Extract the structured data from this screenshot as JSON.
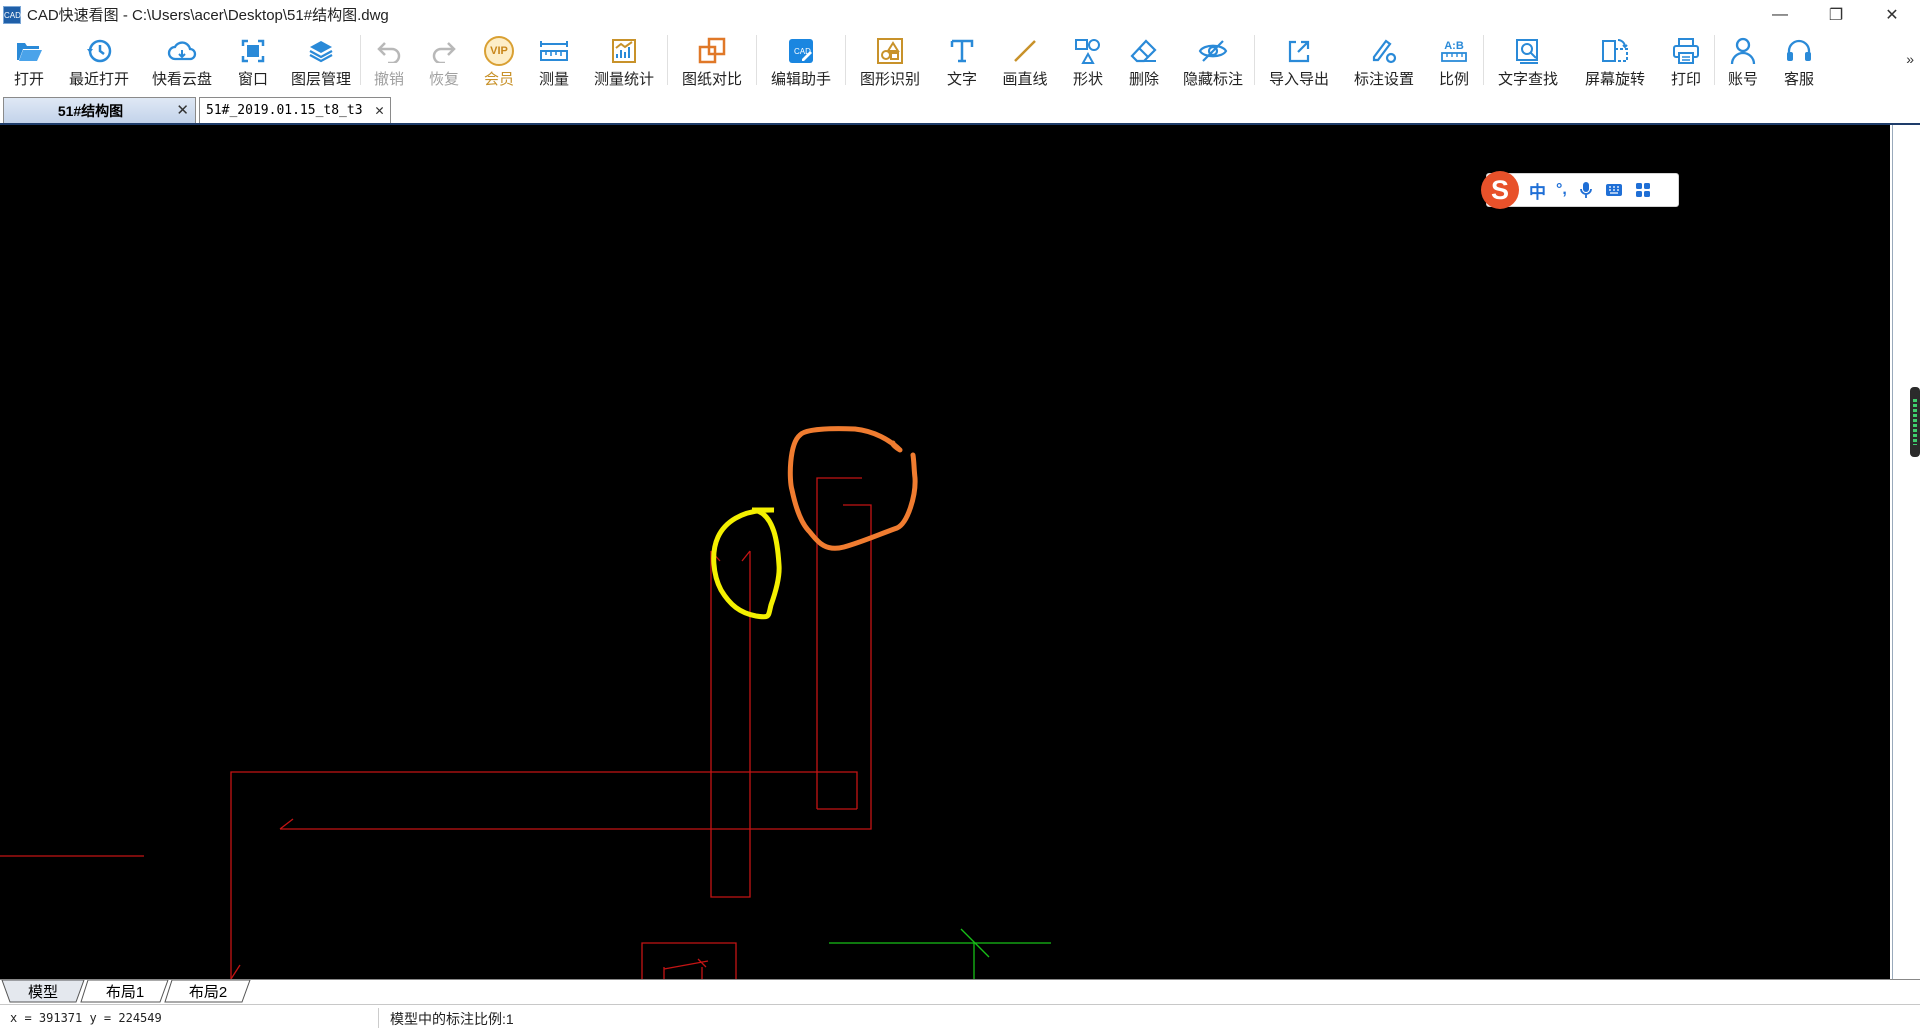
{
  "window": {
    "title": "CAD快速看图 - C:\\Users\\acer\\Desktop\\51#结构图.dwg",
    "logo_text": "CAD",
    "minimize": "—",
    "restore": "❐",
    "close": "✕"
  },
  "toolbar": {
    "open": "打开",
    "recent": "最近打开",
    "cloud": "快看云盘",
    "window": "窗口",
    "layers": "图层管理",
    "undo": "撤销",
    "redo": "恢复",
    "vip": "会员",
    "vip_badge": "VIP",
    "measure": "测量",
    "measure_stats": "测量统计",
    "compare": "图纸对比",
    "edit_helper": "编辑助手",
    "shape_recognition": "图形识别",
    "text": "文字",
    "line": "画直线",
    "shape": "形状",
    "delete": "删除",
    "hide_annotation": "隐藏标注",
    "import_export": "导入导出",
    "annotation_settings": "标注设置",
    "ratio": "比例",
    "ratio_badge": "A:B",
    "text_search": "文字查找",
    "screen_rotate": "屏幕旋转",
    "print": "打印",
    "account": "账号",
    "support": "客服",
    "more": "»"
  },
  "tabs": [
    {
      "label": "51#结构图",
      "close": "✕"
    },
    {
      "label": "51#_2019.01.15_t8_t3",
      "close": "✕"
    }
  ],
  "ime": {
    "logo": "S",
    "mode": "中",
    "punct": "°,"
  },
  "layout_tabs": [
    "模型",
    "布局1",
    "布局2"
  ],
  "status": {
    "coords": "x = 391371  y = 224549",
    "scale": "模型中的标注比例:1"
  },
  "colors": {
    "drawing_line": "#c41414",
    "annotation_yellow": "#f4f000",
    "annotation_orange": "#f07c30",
    "axis_green": "#17c017",
    "toolbar_icon": "#2a8ad8"
  }
}
